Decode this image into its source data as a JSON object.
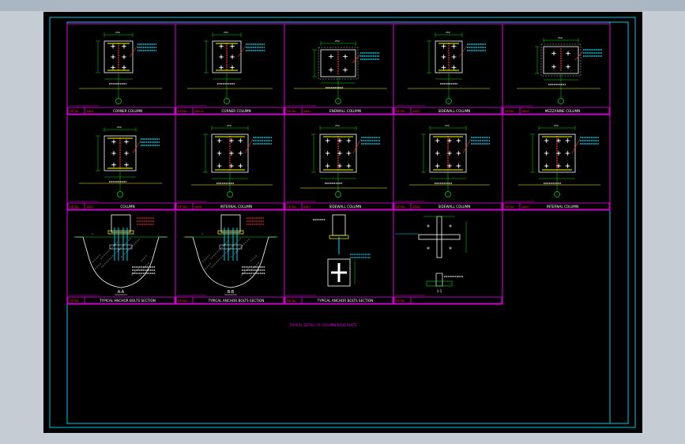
{
  "drawing": {
    "title_note": "TYPICAL DETAIL OF COLUMN BASE PLATE",
    "background_color": "#000000",
    "frame_color": "#00c8e6",
    "grid_color": "#e600e6",
    "text_colors": {
      "green": "#00e000",
      "yellow": "#ffff00",
      "white": "#ffffff",
      "red": "#ff2a2a",
      "cyan": "#00e0ff"
    },
    "details": [
      {
        "id": "det-ab01",
        "ref": "AB01",
        "caption": "CORNER COLUMN"
      },
      {
        "id": "det-ab01a",
        "ref": "AB01a",
        "caption": "CORNER COLUMN"
      },
      {
        "id": "det-ab02",
        "ref": "AB02",
        "caption": "ENDWALL COLUMN"
      },
      {
        "id": "det-ab03",
        "ref": "AB03",
        "caption": "SIDEWALL COLUMN"
      },
      {
        "id": "det-ab04",
        "ref": "AB04",
        "caption": "MEZZANINE COLUMN"
      },
      {
        "id": "det-ab05",
        "ref": "AB05",
        "caption": "COLUMN"
      },
      {
        "id": "det-ab06",
        "ref": "AB06",
        "caption": "INTERNAL COLUMN"
      },
      {
        "id": "det-ab07",
        "ref": "AB07",
        "caption": "SIDEWALL COLUMN"
      },
      {
        "id": "det-ab08",
        "ref": "AB08",
        "caption": "SIDEWALL COLUMN"
      },
      {
        "id": "det-ab09",
        "ref": "AB09",
        "caption": "INTERNAL COLUMN"
      },
      {
        "id": "sec-aa",
        "ref": "",
        "caption": "TYPICAL ANCHOR BOLTS SECTION",
        "section": "A-A"
      },
      {
        "id": "sec-bb",
        "ref": "",
        "caption": "TYPICAL ANCHOR BOLTS SECTION",
        "section": "B-B"
      },
      {
        "id": "sec-bolt",
        "ref": "",
        "caption": "TYPICAL ANCHOR BOLTS SECTION"
      },
      {
        "id": "sec-cross",
        "ref": "",
        "caption": ""
      }
    ]
  }
}
